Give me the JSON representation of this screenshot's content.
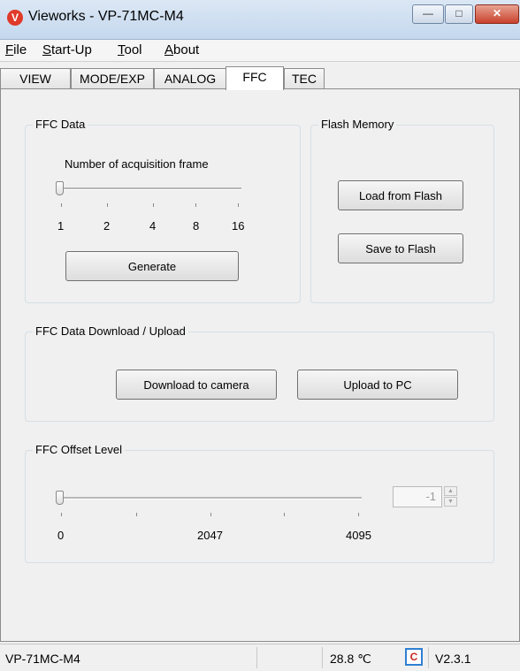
{
  "window": {
    "title": "Vieworks - VP-71MC-M4",
    "icon_letter": "V",
    "minimize": "—",
    "maximize": "□",
    "close": "✕"
  },
  "menu": [
    {
      "label": "File",
      "accel": "F",
      "rest": "ile"
    },
    {
      "label": "Start-Up",
      "accel": "S",
      "rest": "tart-Up"
    },
    {
      "label": "Tool",
      "accel": "T",
      "rest": "ool"
    },
    {
      "label": "About",
      "accel": "A",
      "rest": "bout"
    }
  ],
  "tabs": [
    "VIEW",
    "MODE/EXP",
    "ANALOG",
    "FFC",
    "TEC"
  ],
  "active_tab": "FFC",
  "ffc_data": {
    "title": "FFC Data",
    "slider_label": "Number of acquisition frame",
    "ticks": [
      "1",
      "2",
      "4",
      "8",
      "16"
    ],
    "selected_index": 0,
    "generate_label": "Generate"
  },
  "flash": {
    "title": "Flash Memory",
    "load_label": "Load from Flash",
    "save_label": "Save to Flash"
  },
  "download_upload": {
    "title": "FFC Data Download / Upload",
    "download_label": "Download to camera",
    "upload_label": "Upload to PC"
  },
  "offset": {
    "title": "FFC Offset Level",
    "ticks": [
      "0",
      "2047",
      "4095"
    ],
    "value": "-1",
    "slider_fraction": 0,
    "spin_up": "▲",
    "spin_down": "▼"
  },
  "status": {
    "model": "VP-71MC-M4",
    "temperature": "28.8 ℃",
    "thermo_symbol": "C",
    "version": "V2.3.1"
  }
}
